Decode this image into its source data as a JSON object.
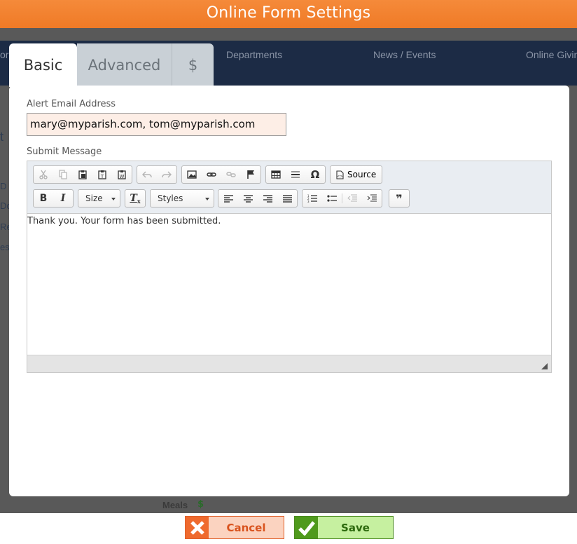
{
  "window": {
    "title": "Online Form Settings"
  },
  "background": {
    "nav_items": [
      "or",
      "Departments",
      "News / Events",
      "Online Givin"
    ],
    "left_fragments": [
      "t",
      "D",
      "Do",
      "Re",
      "es"
    ],
    "meals_label": "Meals"
  },
  "tabs": [
    {
      "label": "Basic",
      "active": true
    },
    {
      "label": "Advanced",
      "active": false
    },
    {
      "label": "$",
      "active": false
    }
  ],
  "form": {
    "alert_email": {
      "label": "Alert Email Address",
      "value": "mary@myparish.com, tom@myparish.com"
    },
    "submit_message": {
      "label": "Submit Message",
      "content": "Thank you. Your form has been submitted."
    }
  },
  "toolbar": {
    "row1_clipboard": [
      "cut-icon",
      "copy-icon",
      "paste-icon",
      "paste-text-icon",
      "paste-word-icon"
    ],
    "row1_history": [
      "undo-icon",
      "redo-icon"
    ],
    "row1_insert": [
      "image-icon",
      "link-icon",
      "unlink-icon",
      "anchor-icon"
    ],
    "row1_table": [
      "table-icon",
      "horizontal-rule-icon",
      "special-char-icon"
    ],
    "source_label": "Source",
    "size_label": "Size",
    "styles_label": "Styles",
    "bold_label": "B",
    "italic_label": "I",
    "special_char_glyph": "Ω",
    "blockquote_glyph": "❞"
  },
  "footer": {
    "cancel_label": "Cancel",
    "save_label": "Save"
  },
  "colors": {
    "title_bar": "#f0802e",
    "cancel_accent": "#ef6a2e",
    "save_accent": "#4f9a1c",
    "email_bg": "#fdeee6"
  }
}
